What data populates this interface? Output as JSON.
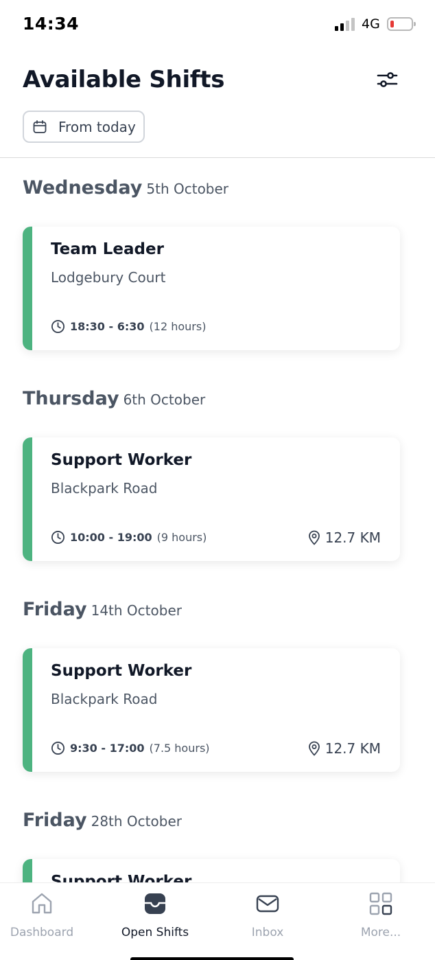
{
  "status_bar": {
    "time": "14:34",
    "network": "4G",
    "signal_bars_active": 2,
    "signal_bars_total": 4,
    "battery_level": "low",
    "battery_color": "#e53935"
  },
  "header": {
    "title": "Available Shifts",
    "filter_icon": "sliders-icon",
    "date_filter_label": "From today",
    "date_filter_icon": "calendar-icon"
  },
  "colors": {
    "accent": "#4db380",
    "text_primary": "#111827",
    "text_secondary": "#4b5563",
    "nav_inactive": "#9ca3af"
  },
  "shifts": [
    {
      "day": "Wednesday",
      "date": "5th October",
      "role": "Team Leader",
      "location": "Lodgebury Court",
      "time": "18:30 - 6:30",
      "duration": "(12 hours)",
      "distance": ""
    },
    {
      "day": "Thursday",
      "date": "6th October",
      "role": "Support Worker",
      "location": "Blackpark Road",
      "time": "10:00 - 19:00",
      "duration": "(9 hours)",
      "distance": "12.7 KM"
    },
    {
      "day": "Friday",
      "date": "14th October",
      "role": "Support Worker",
      "location": "Blackpark Road",
      "time": "9:30 - 17:00",
      "duration": "(7.5 hours)",
      "distance": "12.7 KM"
    },
    {
      "day": "Friday",
      "date": "28th October",
      "role": "Support Worker",
      "location": "",
      "time": "",
      "duration": "",
      "distance": ""
    }
  ],
  "bottom_nav": {
    "items": [
      {
        "label": "Dashboard",
        "icon": "home-icon",
        "active": false
      },
      {
        "label": "Open Shifts",
        "icon": "inbox-tray-icon",
        "active": true
      },
      {
        "label": "Inbox",
        "icon": "mail-icon",
        "active": false
      },
      {
        "label": "More...",
        "icon": "grid-icon",
        "active": false
      }
    ]
  }
}
